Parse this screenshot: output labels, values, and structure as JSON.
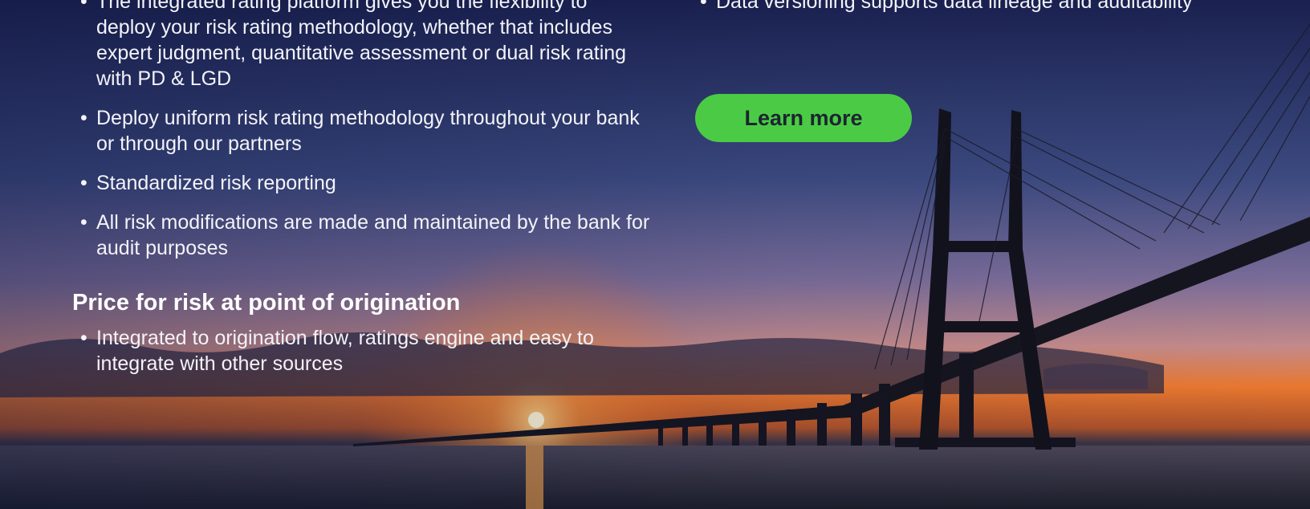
{
  "left_column": {
    "bullets_1": [
      "The integrated rating platform gives you the flexibility to deploy your risk rating methodology, whether that includes expert judgment, quantitative assessment or dual risk rating with PD & LGD",
      "Deploy uniform risk rating methodology throughout your bank or through our partners",
      "Standardized risk reporting",
      "All risk modifications are made and maintained by the bank for audit purposes"
    ],
    "section_heading": "Price for risk at point of origination",
    "bullets_2": [
      "Integrated to origination flow, ratings engine and easy to integrate with other sources"
    ]
  },
  "right_column": {
    "bullets": [
      "Data versioning supports data lineage and auditability"
    ],
    "cta_label": "Learn more"
  },
  "bullet_glyph": "•",
  "colors": {
    "cta_background": "#4bcb45",
    "cta_text": "#1c2430",
    "sky_top": "#1a2150",
    "sunset": "#e8772f"
  },
  "background": {
    "image": "bridge-at-sunset",
    "icon": "bridge-illustration"
  }
}
